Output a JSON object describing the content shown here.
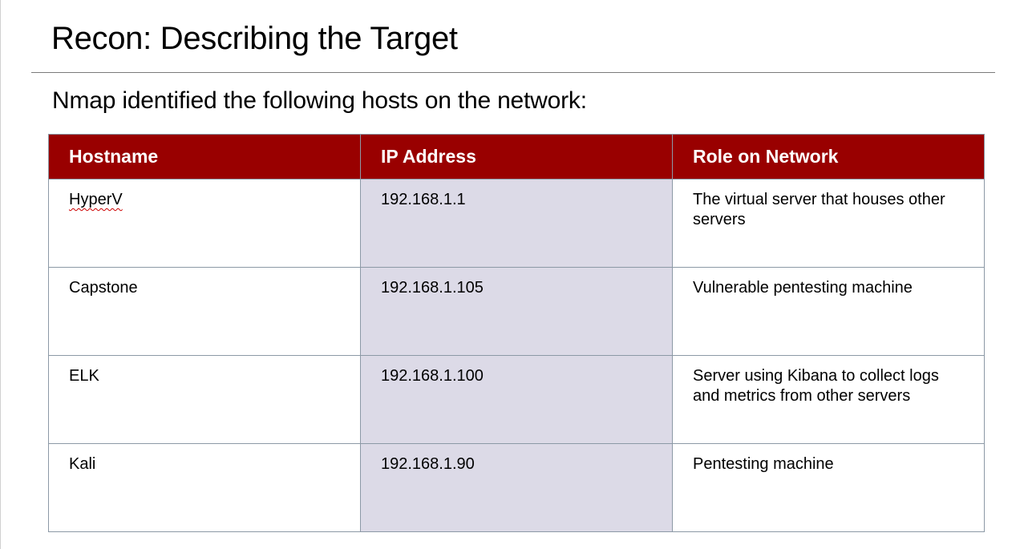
{
  "slide": {
    "title": "Recon: Describing the Target",
    "subtitle": "Nmap identified the following hosts on the network:"
  },
  "table": {
    "headers": [
      "Hostname",
      "IP Address",
      "Role on Network"
    ],
    "header_color": "#990000",
    "ip_column_color": "#dcdae7",
    "rows": [
      {
        "hostname": "HyperV",
        "ip": "192.168.1.1",
        "role": "The virtual server that houses other servers"
      },
      {
        "hostname": "Capstone",
        "ip": "192.168.1.105",
        "role": "Vulnerable pentesting machine"
      },
      {
        "hostname": "ELK",
        "ip": "192.168.1.100",
        "role": "Server using Kibana to collect logs and metrics from other servers"
      },
      {
        "hostname": "Kali",
        "ip": "192.168.1.90",
        "role": "Pentesting machine"
      }
    ]
  }
}
